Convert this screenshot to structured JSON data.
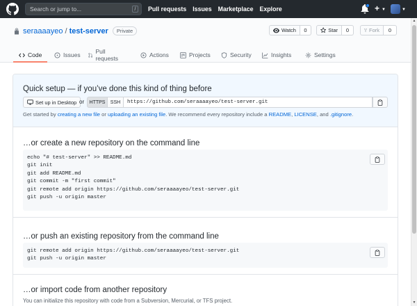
{
  "header": {
    "search_placeholder": "Search or jump to...",
    "search_shortcut": "/",
    "nav": [
      "Pull requests",
      "Issues",
      "Marketplace",
      "Explore"
    ],
    "plus_label": "+"
  },
  "repo": {
    "owner": "seraaaayeo",
    "separator": "/",
    "name": "test-server",
    "visibility": "Private",
    "watch_label": "Watch",
    "watch_count": "0",
    "star_label": "Star",
    "star_count": "0",
    "fork_label": "Fork",
    "fork_count": "0"
  },
  "tabs": [
    {
      "label": "Code",
      "icon": "code-icon",
      "active": true
    },
    {
      "label": "Issues",
      "icon": "issue-icon"
    },
    {
      "label": "Pull requests",
      "icon": "pull-request-icon"
    },
    {
      "label": "Actions",
      "icon": "play-icon"
    },
    {
      "label": "Projects",
      "icon": "project-icon"
    },
    {
      "label": "Security",
      "icon": "shield-icon"
    },
    {
      "label": "Insights",
      "icon": "graph-icon"
    },
    {
      "label": "Settings",
      "icon": "gear-icon"
    }
  ],
  "quick_setup": {
    "title": "Quick setup — if you’ve done this kind of thing before",
    "desktop_label": "Set up in Desktop",
    "or": "or",
    "https_label": "HTTPS",
    "ssh_label": "SSH",
    "clone_url": "https://github.com/seraaaayeo/test-server.git",
    "help_prefix": "Get started by ",
    "help_link1": "creating a new file",
    "help_or": " or ",
    "help_link2": "uploading an existing file",
    "help_mid": ". We recommend every repository include a ",
    "help_readme": "README",
    "help_comma": ", ",
    "help_license": "LICENSE",
    "help_and": ", and ",
    "help_gitignore": ".gitignore",
    "help_end": "."
  },
  "sections": {
    "new_repo": {
      "title": "…or create a new repository on the command line",
      "code": "echo \"# test-server\" >> README.md\ngit init\ngit add README.md\ngit commit -m \"first commit\"\ngit remote add origin https://github.com/seraaaayeo/test-server.git\ngit push -u origin master"
    },
    "push_existing": {
      "title": "…or push an existing repository from the command line",
      "code": "git remote add origin https://github.com/seraaaayeo/test-server.git\ngit push -u origin master"
    },
    "import": {
      "title": "…or import code from another repository",
      "desc": "You can initialize this repository with code from a Subversion, Mercurial, or TFS project."
    }
  },
  "colors": {
    "header_bg": "#24292e",
    "link": "#0366d6",
    "active_tab_underline": "#f9826c",
    "quick_setup_bg": "#f1f8ff"
  }
}
